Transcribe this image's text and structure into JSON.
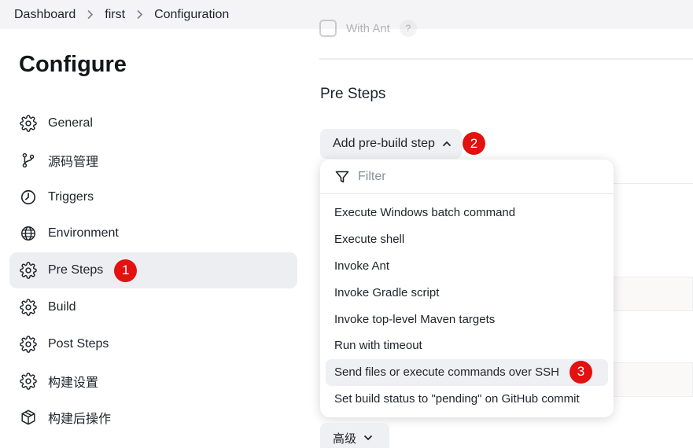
{
  "breadcrumb": {
    "items": [
      "Dashboard",
      "first",
      "Configuration"
    ]
  },
  "sidebar": {
    "title": "Configure",
    "items": [
      {
        "label": "General",
        "icon": "gear-icon"
      },
      {
        "label": "源码管理",
        "icon": "git-branch-icon"
      },
      {
        "label": "Triggers",
        "icon": "clock-icon"
      },
      {
        "label": "Environment",
        "icon": "globe-icon"
      },
      {
        "label": "Pre Steps",
        "icon": "gear-icon",
        "active": true,
        "badge": "1"
      },
      {
        "label": "Build",
        "icon": "gear-icon"
      },
      {
        "label": "Post Steps",
        "icon": "gear-icon"
      },
      {
        "label": "构建设置",
        "icon": "gear-icon"
      },
      {
        "label": "构建后操作",
        "icon": "package-icon"
      }
    ]
  },
  "main": {
    "faded_checkbox_label": "With Ant",
    "section_title": "Pre Steps",
    "add_step_label": "Add pre-build step",
    "add_step_badge": "2",
    "advanced_label": "高级"
  },
  "dropdown": {
    "filter_placeholder": "Filter",
    "items": [
      "Execute Windows batch command",
      "Execute shell",
      "Invoke Ant",
      "Invoke Gradle script",
      "Invoke top-level Maven targets",
      "Run with timeout",
      "Send files or execute commands over SSH",
      "Set build status to \"pending\" on GitHub commit"
    ],
    "highlighted_index": 6,
    "highlighted_badge": "3"
  },
  "colors": {
    "badge": "#e3110f",
    "active_bg": "#eceef2",
    "breadcrumb_bg": "#f4f4f6"
  }
}
